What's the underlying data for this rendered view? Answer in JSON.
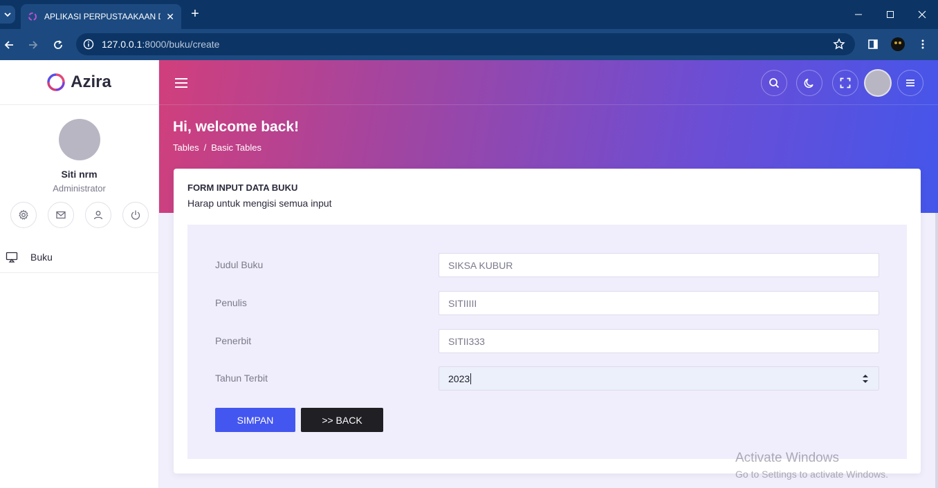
{
  "browser": {
    "tab_title": "APLIKASI PERPUSTAAKAAN DIGITAL",
    "url_host": "127.0.0.1",
    "url_rest": ":8000/buku/create"
  },
  "sidebar": {
    "brand": "Azira",
    "user_name": "Siti nrm",
    "user_role": "Administrator",
    "menu": [
      {
        "label": "Buku",
        "icon": "monitor-icon"
      }
    ]
  },
  "header": {
    "welcome": "Hi, welcome back!",
    "breadcrumb": [
      "Tables",
      "Basic Tables"
    ],
    "breadcrumb_sep": "/"
  },
  "form": {
    "title": "FORM INPUT DATA BUKU",
    "subtitle": "Harap untuk mengisi semua input",
    "fields": [
      {
        "label": "Judul Buku",
        "value": "SIKSA KUBUR"
      },
      {
        "label": "Penulis",
        "value": "SITIIIII"
      },
      {
        "label": "Penerbit",
        "value": "SITII333"
      },
      {
        "label": "Tahun Terbit",
        "value": "2023"
      }
    ],
    "save_label": "SIMPAN",
    "back_label": ">> BACK"
  },
  "watermark": {
    "line1": "Activate Windows",
    "line2": "Go to Settings to activate Windows."
  },
  "colors": {
    "gradient_start": "#d13f7c",
    "gradient_end": "#4456ea",
    "primary": "#4456f0",
    "dark": "#1f1f24"
  }
}
